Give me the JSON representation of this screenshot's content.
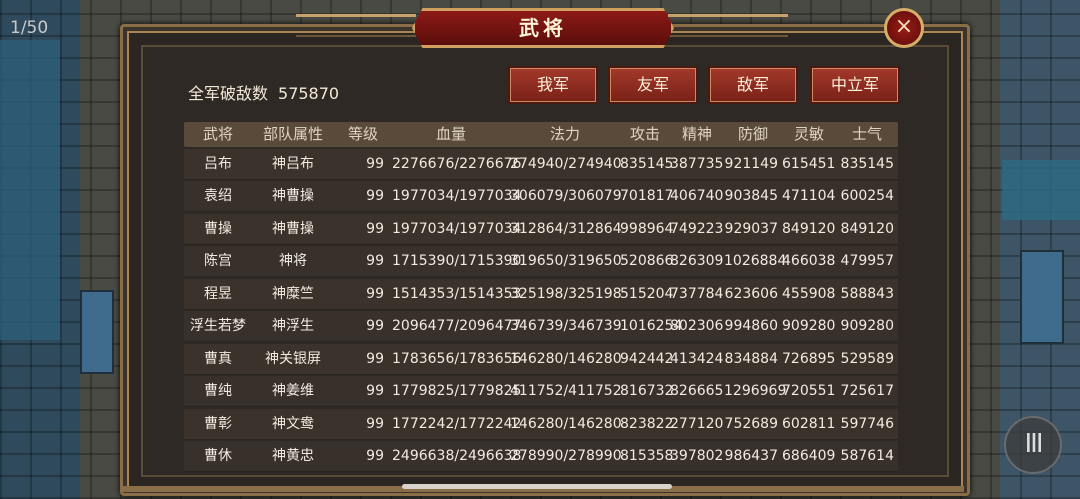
{
  "page_counter": "1/50",
  "title": "武将",
  "close_icon": "×",
  "kills": {
    "label": "全军破敌数",
    "value": "575870"
  },
  "factions": [
    "我军",
    "友军",
    "敌军",
    "中立军"
  ],
  "menu_icon": "III",
  "headers": [
    "武将",
    "部队属性",
    "等级",
    "血量",
    "法力",
    "攻击",
    "精神",
    "防御",
    "灵敏",
    "士气"
  ],
  "rows": [
    [
      "吕布",
      "神吕布",
      "99",
      "2276676/2276676",
      "274940/274940",
      "835145",
      "387735",
      "921149",
      "615451",
      "835145"
    ],
    [
      "袁绍",
      "神曹操",
      "99",
      "1977034/1977034",
      "306079/306079",
      "701817",
      "406740",
      "903845",
      "471104",
      "600254"
    ],
    [
      "曹操",
      "神曹操",
      "99",
      "1977034/1977034",
      "312864/312864",
      "998964",
      "749223",
      "929037",
      "849120",
      "849120"
    ],
    [
      "陈宫",
      "神将",
      "99",
      "1715390/1715390",
      "319650/319650",
      "520866",
      "826309",
      "1026884",
      "466038",
      "479957"
    ],
    [
      "程昱",
      "神糜竺",
      "99",
      "1514353/1514353",
      "325198/325198",
      "515204",
      "737784",
      "623606",
      "455908",
      "588843"
    ],
    [
      "浮生若梦",
      "神浮生",
      "99",
      "2096477/2096477",
      "346739/346739",
      "1016254",
      "802306",
      "994860",
      "909280",
      "909280"
    ],
    [
      "曹真",
      "神关银屏",
      "99",
      "1783656/1783656",
      "146280/146280",
      "942442",
      "413424",
      "834884",
      "726895",
      "529589"
    ],
    [
      "曹纯",
      "神姜维",
      "99",
      "1779825/1779825",
      "411752/411752",
      "816732",
      "826665",
      "1296969",
      "720551",
      "725617"
    ],
    [
      "曹彰",
      "神文鸯",
      "99",
      "1772242/1772242",
      "146280/146280",
      "823822",
      "277120",
      "752689",
      "602811",
      "597746"
    ],
    [
      "曹休",
      "神黄忠",
      "99",
      "2496638/2496638",
      "278990/278990",
      "815358",
      "397802",
      "986437",
      "686409",
      "587614"
    ]
  ]
}
